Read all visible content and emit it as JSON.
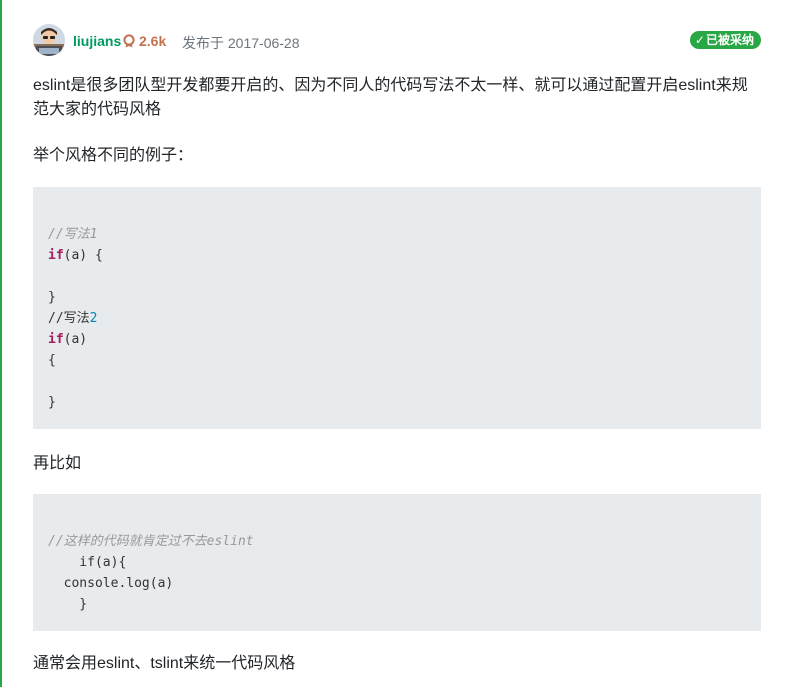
{
  "author": {
    "username": "liujians",
    "reputation": "2.6k",
    "published": "发布于 2017-06-28"
  },
  "accepted_badge": {
    "label": "已被采纳"
  },
  "content": {
    "para1": "eslint是很多团队型开发都要开启的、因为不同人的代码写法不太一样、就可以通过配置开启eslint来规范大家的代码风格",
    "para2": "举个风格不同的例子：",
    "code1": [
      {
        "parts": [
          {
            "text": "//写法1",
            "style": "cmt"
          }
        ]
      },
      {
        "parts": [
          {
            "text": "if",
            "style": "kw"
          },
          {
            "text": "(a) {",
            "style": "plain"
          }
        ]
      },
      {
        "parts": [
          {
            "text": "",
            "style": "plain"
          }
        ]
      },
      {
        "parts": [
          {
            "text": "}",
            "style": "plain"
          }
        ]
      },
      {
        "parts": [
          {
            "text": "//写法",
            "style": "plain"
          },
          {
            "text": "2",
            "style": "num"
          }
        ]
      },
      {
        "parts": [
          {
            "text": "if",
            "style": "kw"
          },
          {
            "text": "(a)",
            "style": "plain"
          }
        ]
      },
      {
        "parts": [
          {
            "text": "{",
            "style": "plain"
          }
        ]
      },
      {
        "parts": [
          {
            "text": "",
            "style": "plain"
          }
        ]
      },
      {
        "parts": [
          {
            "text": "}",
            "style": "plain"
          }
        ]
      }
    ],
    "para3": "再比如",
    "code2": [
      {
        "parts": [
          {
            "text": "//这样的代码就肯定过不去eslint",
            "style": "cmt"
          }
        ]
      },
      {
        "parts": [
          {
            "text": "    if(a){",
            "style": "plain"
          }
        ]
      },
      {
        "parts": [
          {
            "text": "  console.log(a)",
            "style": "plain"
          }
        ]
      },
      {
        "parts": [
          {
            "text": "    }",
            "style": "plain"
          }
        ]
      }
    ],
    "para4": "通常会用eslint、tslint来统一代码风格"
  },
  "colors": {
    "accent_green": "#28a745",
    "username": "#009a61",
    "reputation": "#c2724e",
    "code_bg": "#e7ebee"
  },
  "icons": {
    "reputation": "reputation-medal-icon",
    "accepted": "check-icon",
    "avatar": "user-avatar"
  }
}
